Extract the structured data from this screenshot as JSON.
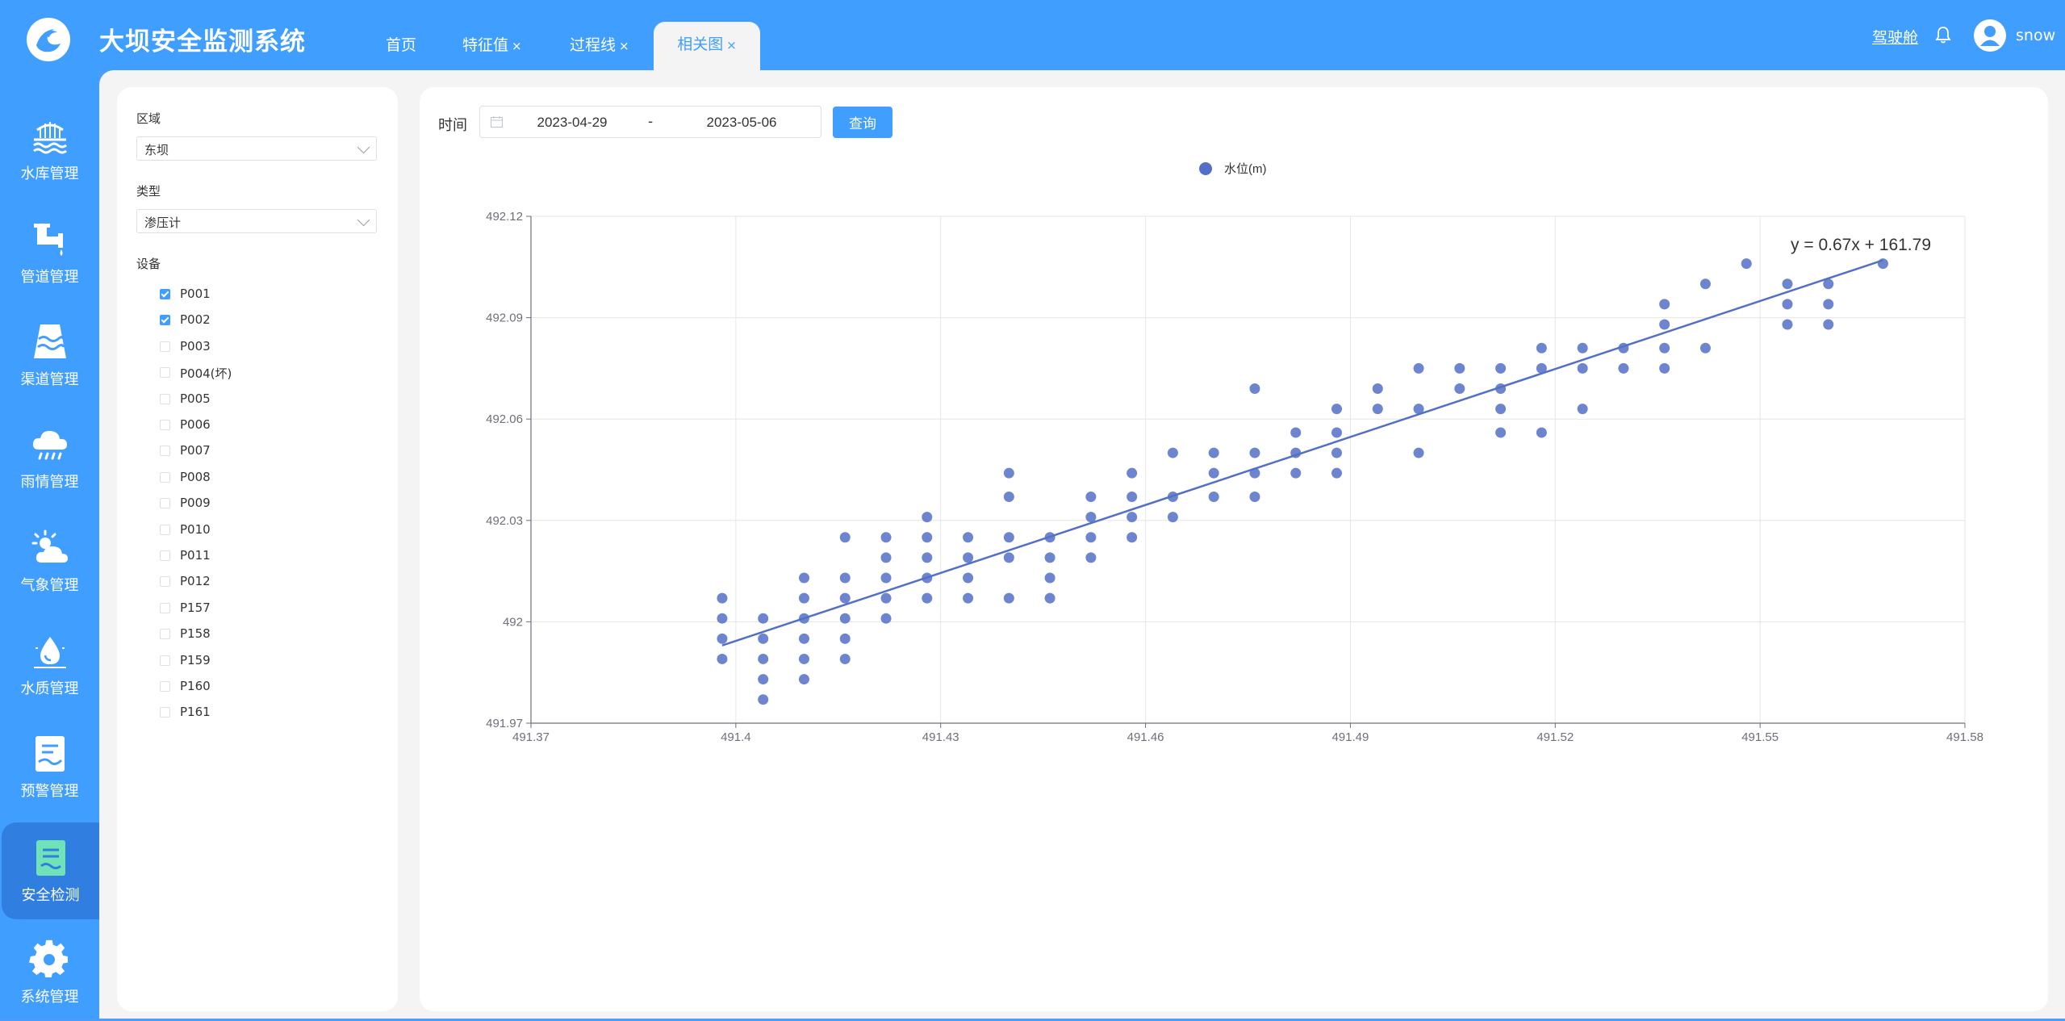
{
  "app": {
    "title": "大坝安全监测系统"
  },
  "tabs": [
    {
      "label": "首页",
      "closable": false,
      "active": false
    },
    {
      "label": "特征值",
      "closable": true,
      "active": false
    },
    {
      "label": "过程线",
      "closable": true,
      "active": false
    },
    {
      "label": "相关图",
      "closable": true,
      "active": true
    }
  ],
  "tab_close_glyph": "×",
  "header_right": {
    "cockpit_link": "驾驶舱",
    "bell_icon": "bell-icon",
    "username": "snow"
  },
  "sidebar": {
    "items": [
      {
        "label": "水库管理",
        "icon": "reservoir-icon"
      },
      {
        "label": "管道管理",
        "icon": "pipe-icon"
      },
      {
        "label": "渠道管理",
        "icon": "channel-icon"
      },
      {
        "label": "雨情管理",
        "icon": "rain-cloud-icon"
      },
      {
        "label": "气象管理",
        "icon": "weather-icon"
      },
      {
        "label": "水质管理",
        "icon": "water-drop-icon"
      },
      {
        "label": "预警管理",
        "icon": "warning-doc-icon"
      },
      {
        "label": "安全检测",
        "icon": "safety-doc-icon",
        "active": true
      },
      {
        "label": "系统管理",
        "icon": "gear-icon"
      }
    ]
  },
  "filters": {
    "region_label": "区域",
    "region_value": "东坝",
    "type_label": "类型",
    "type_value": "渗压计",
    "device_label": "设备",
    "devices": [
      {
        "name": "P001",
        "checked": true
      },
      {
        "name": "P002",
        "checked": true
      },
      {
        "name": "P003",
        "checked": false
      },
      {
        "name": "P004(坏)",
        "checked": false
      },
      {
        "name": "P005",
        "checked": false
      },
      {
        "name": "P006",
        "checked": false
      },
      {
        "name": "P007",
        "checked": false
      },
      {
        "name": "P008",
        "checked": false
      },
      {
        "name": "P009",
        "checked": false
      },
      {
        "name": "P010",
        "checked": false
      },
      {
        "name": "P011",
        "checked": false
      },
      {
        "name": "P012",
        "checked": false
      },
      {
        "name": "P157",
        "checked": false
      },
      {
        "name": "P158",
        "checked": false
      },
      {
        "name": "P159",
        "checked": false
      },
      {
        "name": "P160",
        "checked": false
      },
      {
        "name": "P161",
        "checked": false
      }
    ]
  },
  "query": {
    "time_label": "时间",
    "start_date": "2023-04-29",
    "end_date": "2023-05-06",
    "separator": "-",
    "button_label": "查询"
  },
  "chart_data": {
    "type": "scatter",
    "legend": {
      "entries": [
        "水位(m)"
      ],
      "placement": "top-center"
    },
    "marker_color": "#5470c6",
    "xlim": [
      491.37,
      491.58
    ],
    "ylim": [
      491.97,
      492.12
    ],
    "xticks": [
      "491.37",
      "491.4",
      "491.43",
      "491.46",
      "491.49",
      "491.52",
      "491.55",
      "491.58"
    ],
    "yticks": [
      "491.97",
      "492",
      "492.03",
      "492.06",
      "492.09",
      "492.12"
    ],
    "grid": true,
    "trendline": {
      "x": [
        491.398,
        491.568
      ],
      "y": [
        491.993,
        492.107
      ],
      "label": "y = 0.67x + 161.79"
    },
    "series": [
      {
        "name": "水位(m)",
        "points": [
          [
            491.398,
            492.007
          ],
          [
            491.398,
            492.001
          ],
          [
            491.398,
            491.995
          ],
          [
            491.398,
            491.989
          ],
          [
            491.404,
            492.001
          ],
          [
            491.404,
            491.995
          ],
          [
            491.404,
            491.989
          ],
          [
            491.404,
            491.983
          ],
          [
            491.404,
            491.977
          ],
          [
            491.41,
            492.013
          ],
          [
            491.41,
            492.007
          ],
          [
            491.41,
            492.001
          ],
          [
            491.41,
            491.995
          ],
          [
            491.41,
            491.989
          ],
          [
            491.41,
            491.983
          ],
          [
            491.416,
            492.025
          ],
          [
            491.416,
            492.013
          ],
          [
            491.416,
            492.007
          ],
          [
            491.416,
            492.001
          ],
          [
            491.416,
            491.995
          ],
          [
            491.416,
            491.989
          ],
          [
            491.422,
            492.025
          ],
          [
            491.422,
            492.019
          ],
          [
            491.422,
            492.013
          ],
          [
            491.422,
            492.007
          ],
          [
            491.422,
            492.001
          ],
          [
            491.428,
            492.031
          ],
          [
            491.428,
            492.025
          ],
          [
            491.428,
            492.019
          ],
          [
            491.428,
            492.013
          ],
          [
            491.428,
            492.007
          ],
          [
            491.434,
            492.025
          ],
          [
            491.434,
            492.019
          ],
          [
            491.434,
            492.013
          ],
          [
            491.434,
            492.007
          ],
          [
            491.44,
            492.044
          ],
          [
            491.44,
            492.037
          ],
          [
            491.44,
            492.025
          ],
          [
            491.44,
            492.019
          ],
          [
            491.44,
            492.007
          ],
          [
            491.446,
            492.025
          ],
          [
            491.446,
            492.019
          ],
          [
            491.446,
            492.013
          ],
          [
            491.446,
            492.007
          ],
          [
            491.452,
            492.037
          ],
          [
            491.452,
            492.031
          ],
          [
            491.452,
            492.025
          ],
          [
            491.452,
            492.019
          ],
          [
            491.458,
            492.044
          ],
          [
            491.458,
            492.037
          ],
          [
            491.458,
            492.031
          ],
          [
            491.458,
            492.025
          ],
          [
            491.464,
            492.05
          ],
          [
            491.464,
            492.037
          ],
          [
            491.464,
            492.031
          ],
          [
            491.47,
            492.05
          ],
          [
            491.47,
            492.044
          ],
          [
            491.47,
            492.037
          ],
          [
            491.476,
            492.069
          ],
          [
            491.476,
            492.05
          ],
          [
            491.476,
            492.044
          ],
          [
            491.476,
            492.037
          ],
          [
            491.482,
            492.056
          ],
          [
            491.482,
            492.05
          ],
          [
            491.482,
            492.044
          ],
          [
            491.488,
            492.063
          ],
          [
            491.488,
            492.056
          ],
          [
            491.488,
            492.05
          ],
          [
            491.488,
            492.044
          ],
          [
            491.494,
            492.069
          ],
          [
            491.494,
            492.063
          ],
          [
            491.5,
            492.075
          ],
          [
            491.5,
            492.063
          ],
          [
            491.5,
            492.05
          ],
          [
            491.506,
            492.075
          ],
          [
            491.506,
            492.069
          ],
          [
            491.512,
            492.075
          ],
          [
            491.512,
            492.069
          ],
          [
            491.512,
            492.063
          ],
          [
            491.512,
            492.056
          ],
          [
            491.518,
            492.081
          ],
          [
            491.518,
            492.075
          ],
          [
            491.518,
            492.056
          ],
          [
            491.524,
            492.081
          ],
          [
            491.524,
            492.075
          ],
          [
            491.524,
            492.063
          ],
          [
            491.53,
            492.081
          ],
          [
            491.53,
            492.075
          ],
          [
            491.536,
            492.094
          ],
          [
            491.536,
            492.088
          ],
          [
            491.536,
            492.081
          ],
          [
            491.536,
            492.075
          ],
          [
            491.542,
            492.1
          ],
          [
            491.542,
            492.081
          ],
          [
            491.548,
            492.106
          ],
          [
            491.554,
            492.1
          ],
          [
            491.554,
            492.094
          ],
          [
            491.554,
            492.088
          ],
          [
            491.56,
            492.1
          ],
          [
            491.56,
            492.094
          ],
          [
            491.56,
            492.088
          ],
          [
            491.568,
            492.106
          ]
        ]
      }
    ]
  }
}
